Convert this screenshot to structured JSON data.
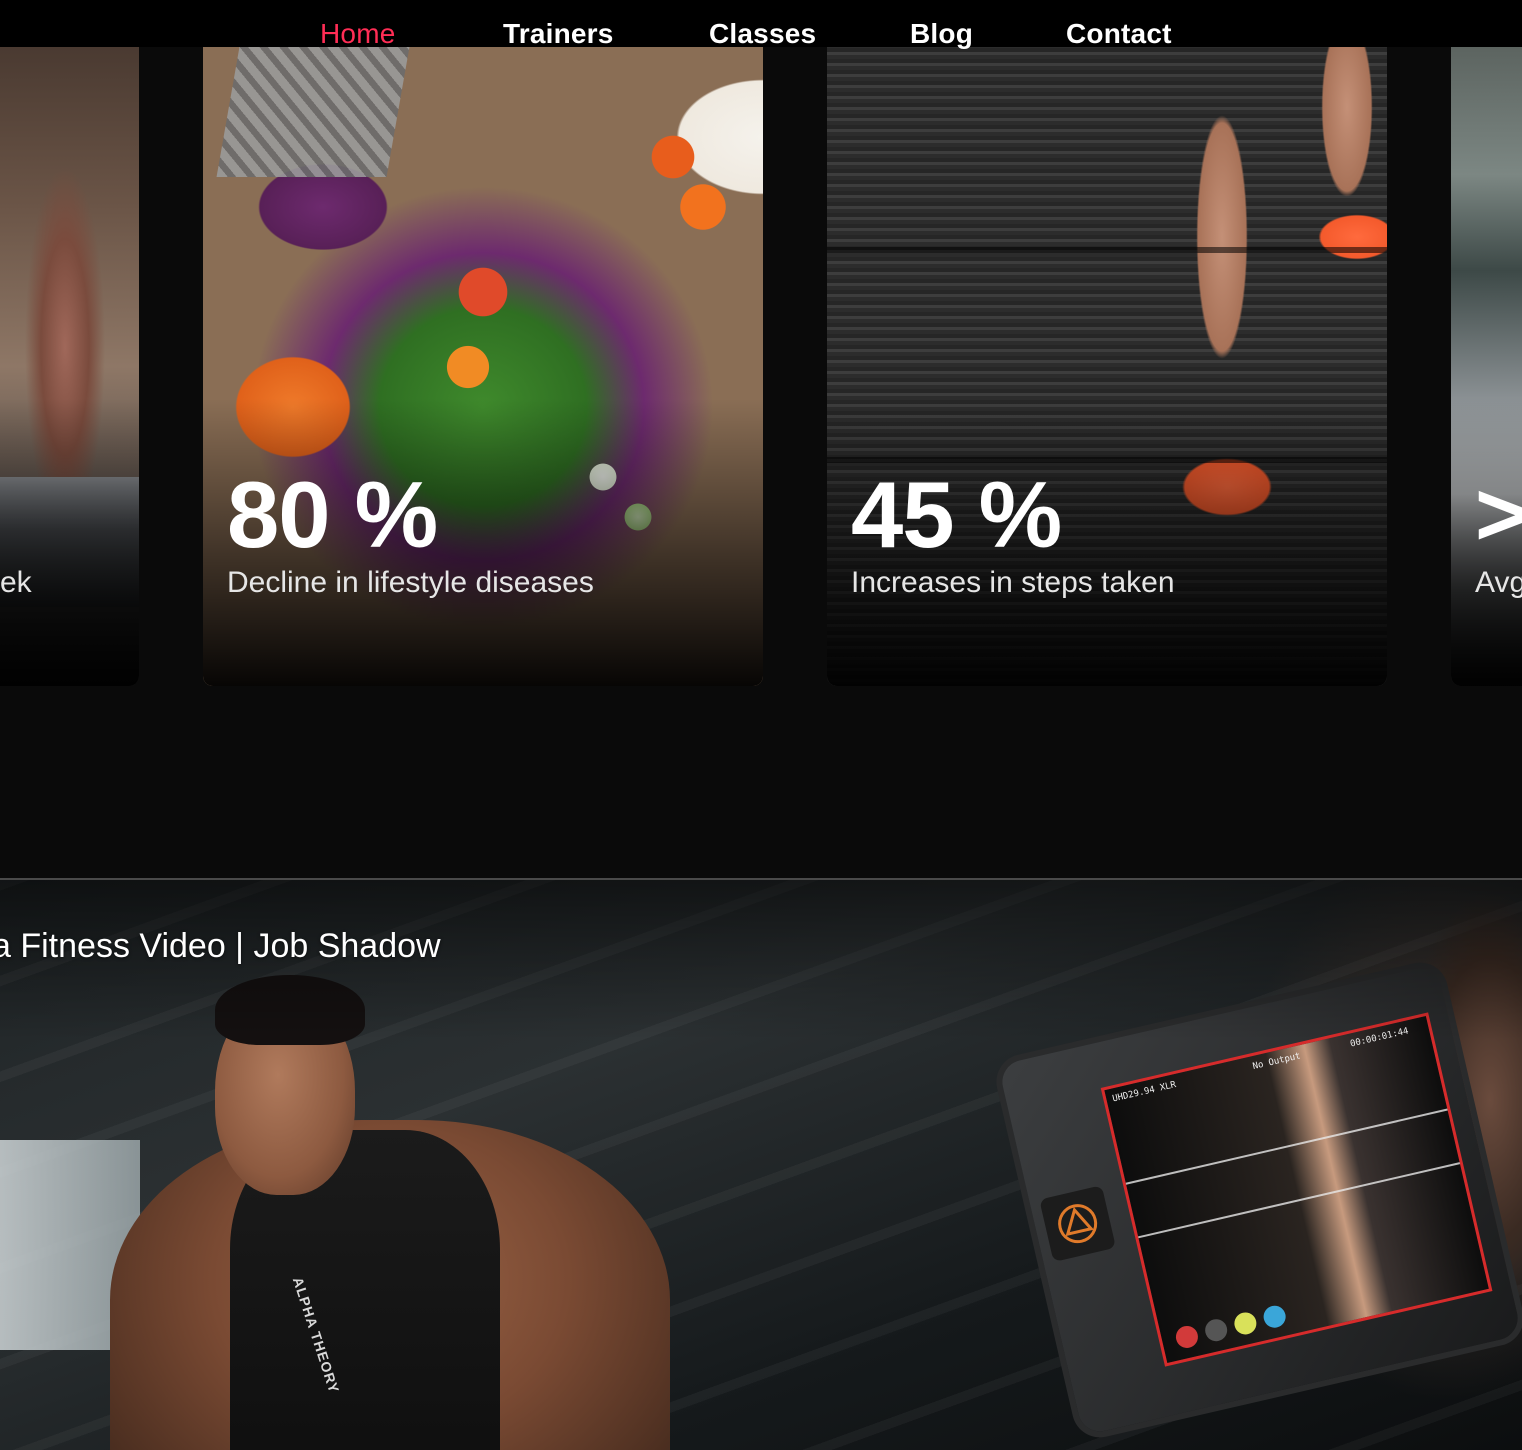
{
  "nav": {
    "items": [
      {
        "label": "Home",
        "active": true
      },
      {
        "label": "Trainers",
        "active": false
      },
      {
        "label": "Classes",
        "active": false
      },
      {
        "label": "Blog",
        "active": false
      },
      {
        "label": "Contact",
        "active": false
      }
    ],
    "active_color": "#ff2d55",
    "text_color": "#ffffff"
  },
  "stats": {
    "cards": [
      {
        "value": "",
        "description": "ek"
      },
      {
        "value": "80 %",
        "description": "Decline in lifestyle diseases"
      },
      {
        "value": "45 %",
        "description": "Increases in steps taken"
      },
      {
        "value": ">",
        "description": "Avg"
      }
    ]
  },
  "video": {
    "title": "a Fitness Video | Job Shadow",
    "shirt_text": "ALPHA THEORY",
    "monitor": {
      "format": "UHD29.94 XLR",
      "output": "No Output",
      "timecode": "00:00:01:44"
    }
  },
  "colors": {
    "background": "#0a0a0a",
    "accent": "#ff2d55",
    "monitor_frame": "#d62b2b"
  }
}
